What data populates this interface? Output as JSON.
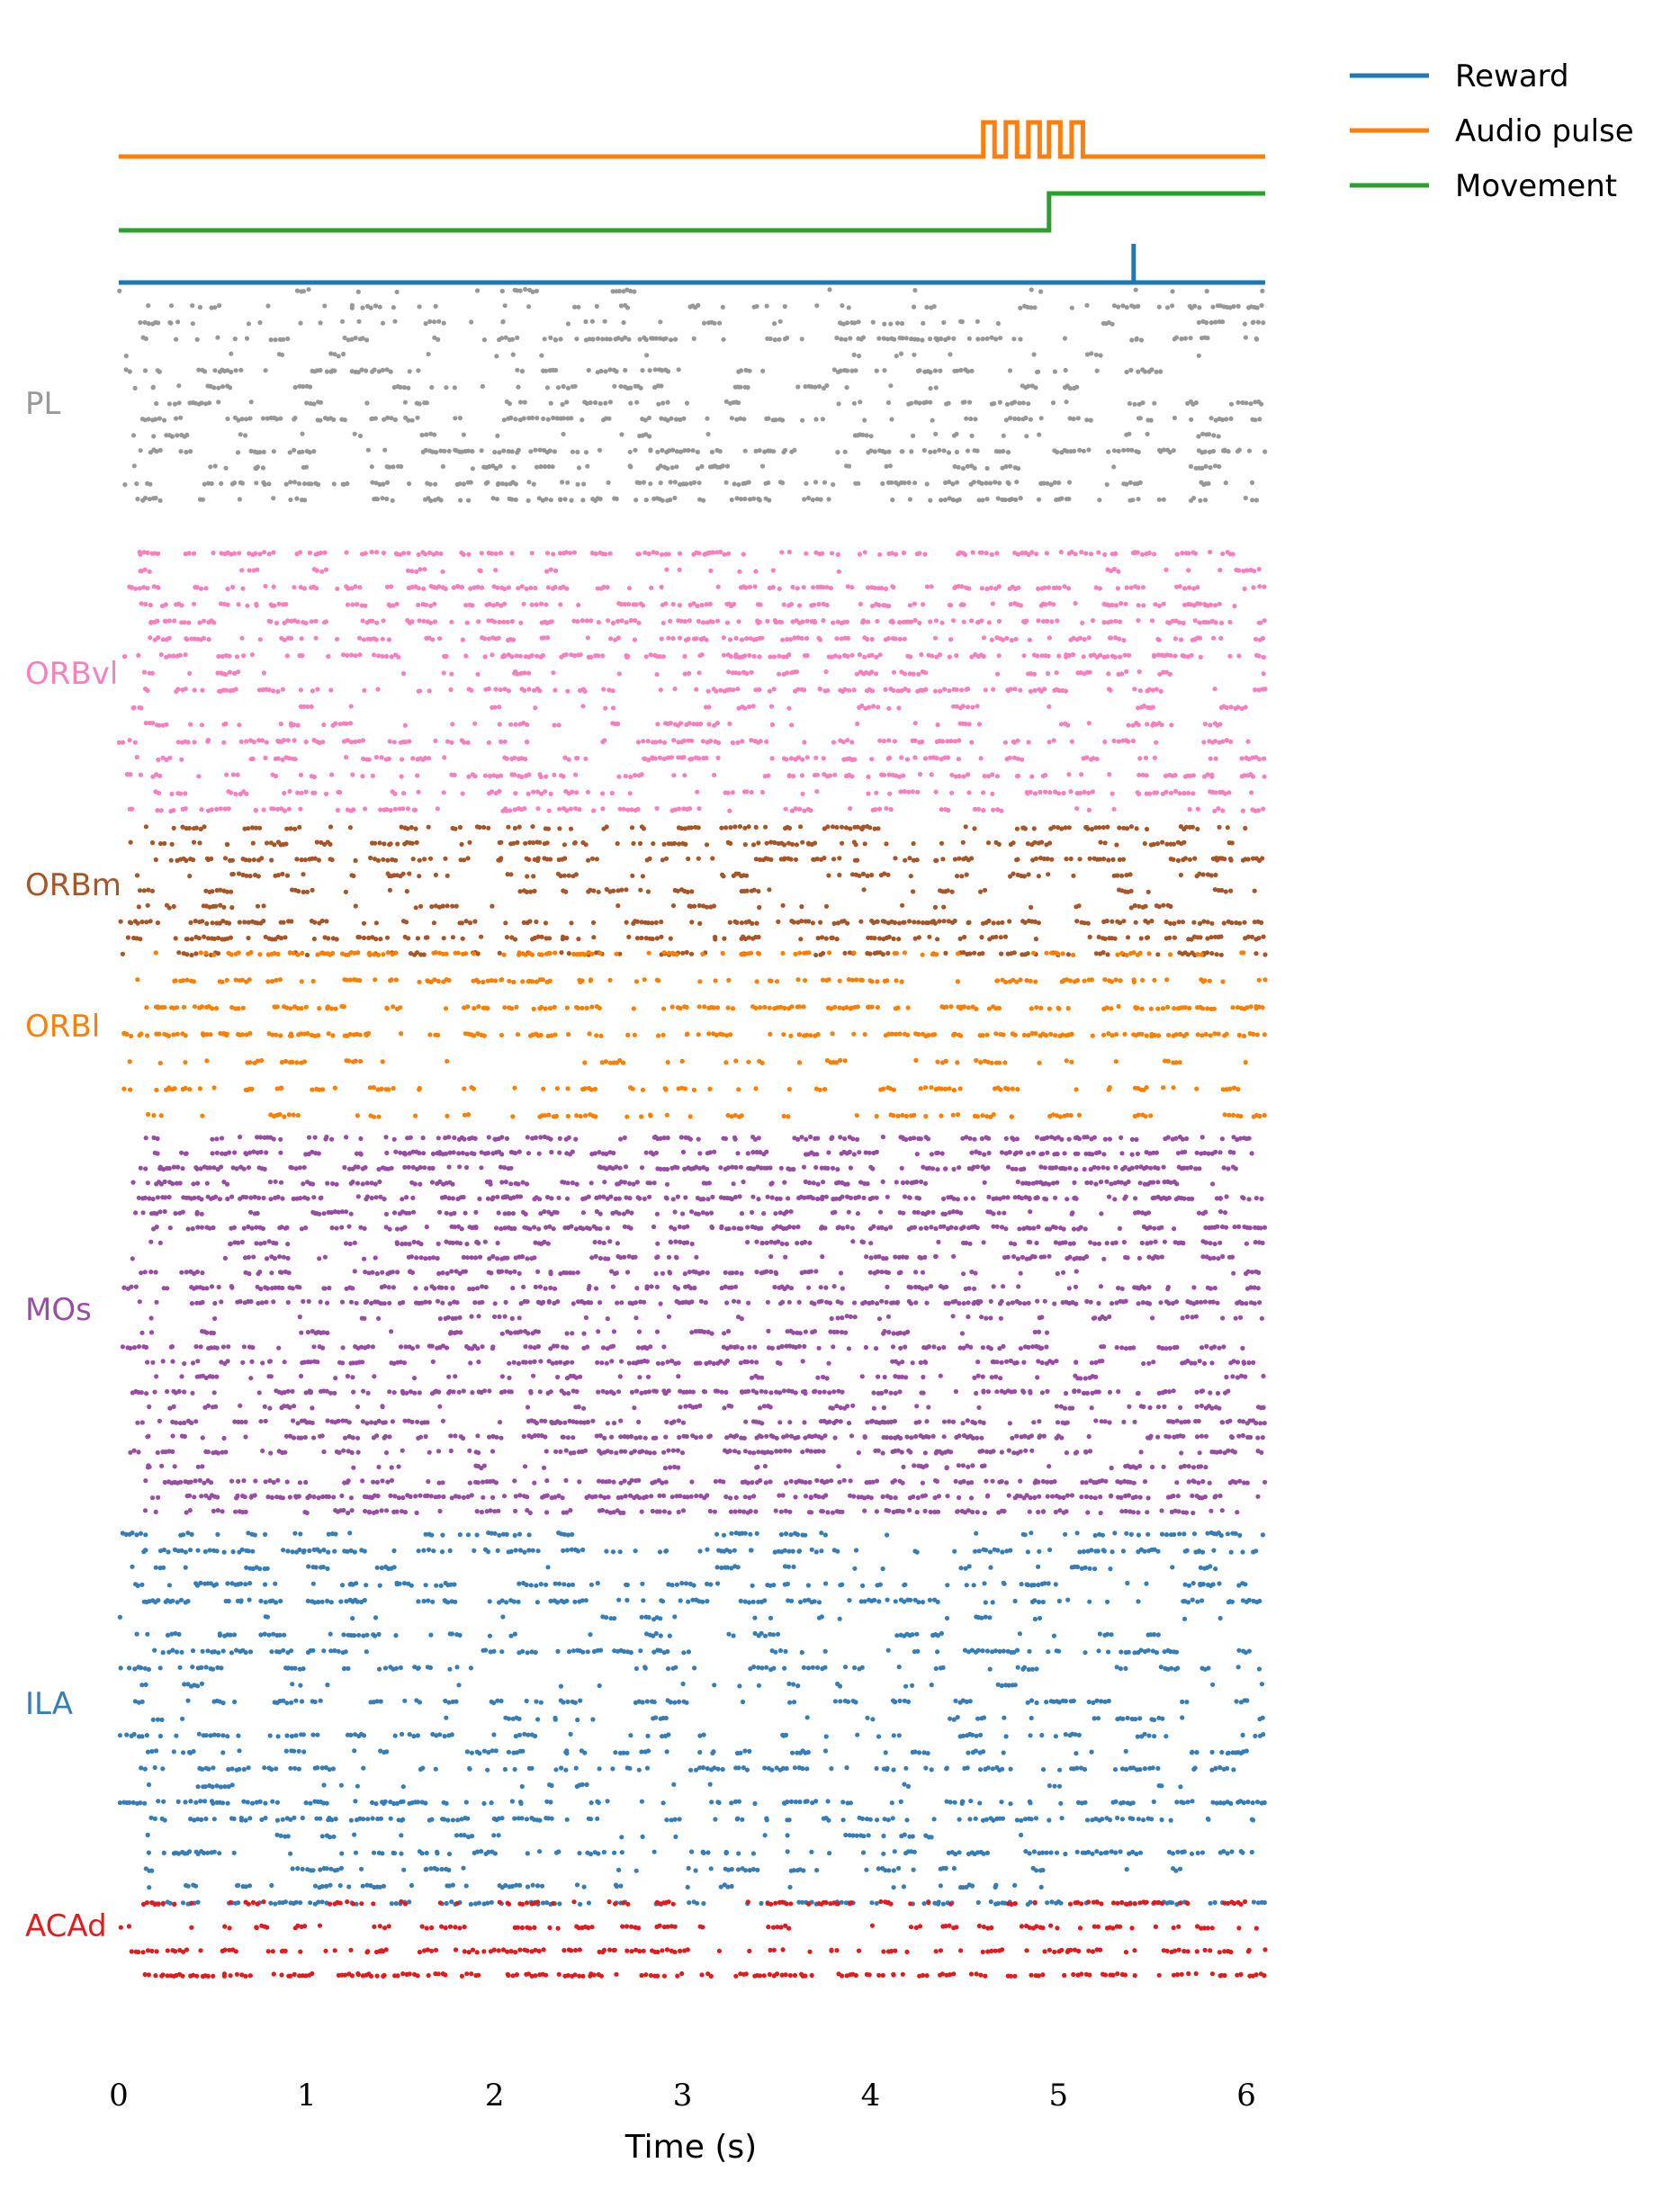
{
  "chart_data": {
    "type": "scatter",
    "subtype": "spike-raster",
    "xlabel": "Time (s)",
    "xlim": [
      0,
      6.1
    ],
    "xticks": [
      0,
      1,
      2,
      3,
      4,
      5,
      6
    ],
    "xtick_labels": [
      "0",
      "1",
      "2",
      "3",
      "4",
      "5",
      "6"
    ],
    "grid": false,
    "legend_position": "top-right",
    "legend": [
      {
        "label": "Reward",
        "color": "#1f77b4"
      },
      {
        "label": "Audio pulse",
        "color": "#ff7f0e"
      },
      {
        "label": "Movement",
        "color": "#2ca02c"
      }
    ],
    "event_traces": [
      {
        "name": "Audio pulse",
        "color": "#ff7f0e",
        "type": "pulse-train",
        "on_times": [
          4.6,
          4.72,
          4.84,
          4.95,
          5.07
        ],
        "pulse_width": 0.06
      },
      {
        "name": "Movement",
        "color": "#2ca02c",
        "type": "step",
        "step_time": 4.95
      },
      {
        "name": "Reward",
        "color": "#1f77b4",
        "type": "impulse",
        "time": 5.4
      }
    ],
    "regions": [
      {
        "name": "PL",
        "color": "#999999",
        "units": 14,
        "mean_rate_hz": 9
      },
      {
        "name": "ORBvl",
        "color": "#f781bf",
        "units": 16,
        "mean_rate_hz": 14
      },
      {
        "name": "ORBm",
        "color": "#a65628",
        "units": 9,
        "mean_rate_hz": 11
      },
      {
        "name": "ORBl",
        "color": "#ff7f00",
        "units": 7,
        "mean_rate_hz": 16
      },
      {
        "name": "MOs",
        "color": "#984ea3",
        "units": 26,
        "mean_rate_hz": 15
      },
      {
        "name": "ILA",
        "color": "#377eb8",
        "units": 23,
        "mean_rate_hz": 10
      },
      {
        "name": "ACAd",
        "color": "#e41a1c",
        "units": 4,
        "mean_rate_hz": 16
      }
    ],
    "note_on_spikes": ""
  }
}
